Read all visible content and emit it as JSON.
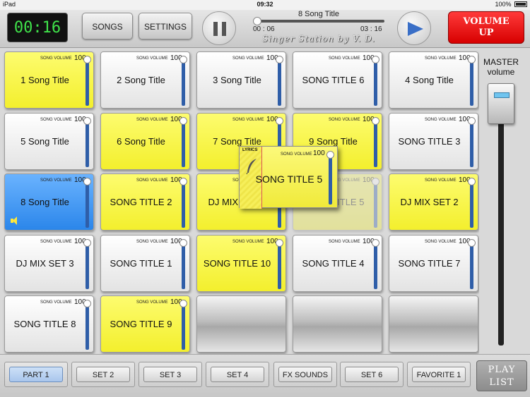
{
  "status": {
    "device": "iPad",
    "time": "09:32",
    "battery": "100%"
  },
  "toolbar": {
    "timer": "00:16",
    "songs_label": "SONGS",
    "settings_label": "SETTINGS",
    "now_playing": "8 Song Title",
    "elapsed": "00 : 06",
    "duration": "03 : 16",
    "progress": 0.03,
    "brand": "Singer Station by V. D.",
    "volume_up_line1": "VOLUME",
    "volume_up_line2": "UP"
  },
  "pad_common": {
    "volume_label": "SONG VOLUME",
    "volume_value": "100"
  },
  "pads": [
    {
      "title": "1 Song Title",
      "color": "yellow"
    },
    {
      "title": "2 Song Title",
      "color": "white"
    },
    {
      "title": "3 Song Title",
      "color": "white"
    },
    {
      "title": "SONG TITLE 6",
      "color": "white"
    },
    {
      "title": "4 Song Title",
      "color": "white"
    },
    {
      "title": "5 Song Title",
      "color": "white"
    },
    {
      "title": "6 Song Title",
      "color": "yellow"
    },
    {
      "title": "7 Song Title",
      "color": "yellow"
    },
    {
      "title": "9 Song Title",
      "color": "yellow"
    },
    {
      "title": "SONG TITLE 3",
      "color": "white"
    },
    {
      "title": "8 Song Title",
      "color": "blue",
      "playing": true
    },
    {
      "title": "SONG TITLE 2",
      "color": "yellow"
    },
    {
      "title": "DJ MIX SET 1",
      "color": "yellow"
    },
    {
      "title": "SONG TITLE 5",
      "color": "yellow",
      "faded": true
    },
    {
      "title": "DJ MIX SET 2",
      "color": "yellow"
    },
    {
      "title": "DJ MIX SET 3",
      "color": "white"
    },
    {
      "title": "SONG TITLE 1",
      "color": "white"
    },
    {
      "title": "SONG TITLE 10",
      "color": "yellow"
    },
    {
      "title": "SONG TITLE 4",
      "color": "white"
    },
    {
      "title": "SONG TITLE 7",
      "color": "white"
    },
    {
      "title": "SONG TITLE 8",
      "color": "white"
    },
    {
      "title": "SONG TITLE 9",
      "color": "yellow"
    },
    {
      "title": "",
      "color": "empty"
    },
    {
      "title": "",
      "color": "empty"
    },
    {
      "title": "",
      "color": "empty"
    }
  ],
  "drag_pad": {
    "lyrics_label": "LYRICS",
    "title": "SONG TITLE 5"
  },
  "master": {
    "label_line1": "MASTER",
    "label_line2": "volume"
  },
  "sets": [
    {
      "label": "PART 1",
      "active": true
    },
    {
      "label": "SET 2"
    },
    {
      "label": "SET 3"
    },
    {
      "label": "SET 4"
    },
    {
      "label": "FX SOUNDS"
    },
    {
      "label": "SET 6"
    },
    {
      "label": "FAVORITE 1"
    }
  ],
  "playlist": {
    "line1": "PLAY",
    "line2": "LIST"
  }
}
